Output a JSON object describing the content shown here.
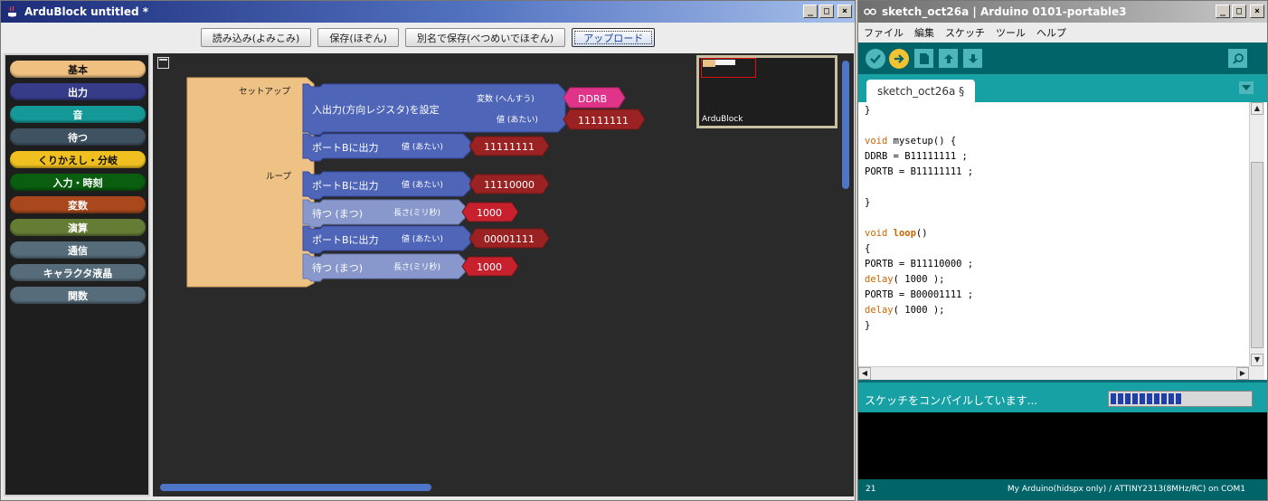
{
  "ardublock": {
    "title": "ArduBlock untitled *",
    "window_buttons": {
      "minimize": "_",
      "maximize": "□",
      "close": "×"
    },
    "toolbar": {
      "open": "読み込み(よみこみ)",
      "save": "保存(ほぞん)",
      "save_as": "別名で保存(べつめいでほぞん)",
      "upload": "アップロード"
    },
    "palette": [
      {
        "label": "基本",
        "color": "#f0c080"
      },
      {
        "label": "出力",
        "color": "#363c88"
      },
      {
        "label": "音",
        "color": "#149898"
      },
      {
        "label": "待つ",
        "color": "#3e5262"
      },
      {
        "label": "くりかえし・分岐",
        "color": "#f0c020"
      },
      {
        "label": "入力・時刻",
        "color": "#0a5e10"
      },
      {
        "label": "変数",
        "color": "#a8481c"
      },
      {
        "label": "演算",
        "color": "#647c34"
      },
      {
        "label": "通信",
        "color": "#566c7a"
      },
      {
        "label": "キャラクタ液晶",
        "color": "#566c7a"
      },
      {
        "label": "関数",
        "color": "#566c7a"
      }
    ],
    "program": {
      "setup_label": "セットアップ",
      "loop_label": "ループ",
      "pinmode": {
        "label": "入出力(方向レジスタ)を設定",
        "var_label": "変数 (へんすう)",
        "var_value": "DDRB",
        "val_label": "値 (あたい)",
        "val_value": "11111111"
      },
      "blocks": [
        {
          "label": "ポートBに出力",
          "param": "値 (あたい)",
          "value": "11111111",
          "kind": "output"
        },
        {
          "label": "ポートBに出力",
          "param": "値 (あたい)",
          "value": "11110000",
          "kind": "output"
        },
        {
          "label": "待つ (まつ)",
          "param": "長さ(ミリ秒)",
          "value": "1000",
          "kind": "wait"
        },
        {
          "label": "ポートBに出力",
          "param": "値 (あたい)",
          "value": "00001111",
          "kind": "output"
        },
        {
          "label": "待つ (まつ)",
          "param": "長さ(ミリ秒)",
          "value": "1000",
          "kind": "wait"
        }
      ]
    },
    "minimap_label": "ArduBlock"
  },
  "arduino": {
    "title": "sketch_oct26a | Arduino 0101-portable3",
    "window_buttons": {
      "minimize": "_",
      "maximize": "□",
      "close": "×"
    },
    "menu": [
      "ファイル",
      "編集",
      "スケッチ",
      "ツール",
      "ヘルプ"
    ],
    "tab": "sketch_oct26a §",
    "code": [
      [
        {
          "t": "}"
        }
      ],
      [],
      [
        {
          "t": "void",
          "c": "kw"
        },
        {
          "t": " mysetup() {"
        }
      ],
      [
        {
          "t": "DDRB = B11111111 ;"
        }
      ],
      [
        {
          "t": "PORTB = B11111111 ;"
        }
      ],
      [],
      [
        {
          "t": "}"
        }
      ],
      [],
      [
        {
          "t": "void",
          "c": "kw"
        },
        {
          "t": " "
        },
        {
          "t": "loop",
          "c": "kwb"
        },
        {
          "t": "()"
        }
      ],
      [
        {
          "t": "{"
        }
      ],
      [
        {
          "t": "PORTB = B11110000 ;"
        }
      ],
      [
        {
          "t": "delay",
          "c": "kw"
        },
        {
          "t": "( 1000 );"
        }
      ],
      [
        {
          "t": "PORTB = B00001111 ;"
        }
      ],
      [
        {
          "t": "delay",
          "c": "kw"
        },
        {
          "t": "( 1000 );"
        }
      ],
      [
        {
          "t": "}"
        }
      ]
    ],
    "status": "スケッチをコンパイルしています...",
    "progress": 0.5,
    "footer_line": "21",
    "footer_board": "My Arduino(hidspx only) / ATTINY2313(8MHz/RC) on COM1"
  }
}
